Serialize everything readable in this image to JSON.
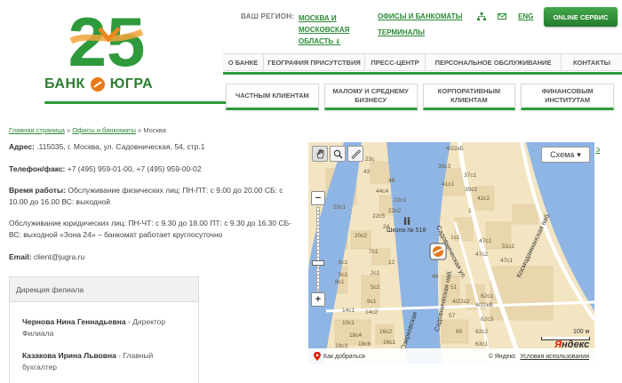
{
  "header": {
    "logo_number": "25",
    "logo_brand": "БАНК  ЮГРА",
    "region_label": "ВАШ РЕГИОН:",
    "region_value": "МОСКВА И МОСКОВСКАЯ ОБЛАСТЬ",
    "region_arrow": "⇓",
    "offices_link": "ОФИСЫ И БАНКОМАТЫ",
    "terminals_link": "ТЕРМИНАЛЫ",
    "lang_link": "ENG",
    "online_button": "ONLINE СЕРВИС",
    "icons": {
      "sitemap": "sitemap-icon",
      "mail": "mail-icon"
    }
  },
  "main_nav": [
    {
      "label": "О БАНКЕ"
    },
    {
      "label": "ГЕОГРАФИЯ ПРИСУТСТВИЯ"
    },
    {
      "label": "ПРЕСС-ЦЕНТР"
    },
    {
      "label": "ПЕРСОНАЛЬНОЕ ОБСЛУЖИВАНИЕ"
    },
    {
      "label": "КОНТАКТЫ"
    }
  ],
  "sub_nav": [
    {
      "label": "ЧАСТНЫМ КЛИЕНТАМ"
    },
    {
      "label": "МАЛОМУ И СРЕДНЕМУ БИЗНЕСУ"
    },
    {
      "label": "КОРПОРАТИВНЫМ КЛИЕНТАМ"
    },
    {
      "label": "ФИНАНСОВЫМ ИНСТИТУТАМ"
    }
  ],
  "breadcrumb": {
    "home": "Главная страница",
    "sep1": " » ",
    "section": "Офисы и банкоматы",
    "sep2": " » ",
    "current": "Москва"
  },
  "info": {
    "address_label": "Адрес:",
    "address_value": " .115035, г. Москва, ул. Садовническая, 54, стр.1",
    "phone_label": "Телефон/факс:",
    "phone_value": " +7 (495) 959-01-00, +7 (495) 959-00-02",
    "hours_label": "Время работы:",
    "hours_value": " Обслуживание физических лиц: ПН-ПТ: с 9.00 до 20.00 СБ: с 10.00 до 16.00 ВС: выходной",
    "legal_hours": "Обслуживание юридических лиц: ПН-ЧТ: с 9.30 до 18.00 ПТ: с 9.30 до 16.30 СБ-ВС: выходной «Зона 24» – банкомат работает круглосуточно",
    "email_label": "Email:",
    "email_value": " client@jugra.ru"
  },
  "branch": {
    "header": "Дирекция филиала",
    "people": [
      {
        "name": "Чернова Нина Геннадьевна",
        "role": " - Директор Филиала"
      },
      {
        "name": "Казакова Ирина Львовна",
        "role": " - Главный бухгалтер"
      }
    ]
  },
  "map": {
    "scheme_button": "Схема",
    "scheme_arrow": "▾",
    "scale_label": "100 м",
    "yandex_y": "Я",
    "yandex_rest": "ндекс",
    "route_link": "Как добраться",
    "copyright": "© Яндекс",
    "terms_link": "Условия использования",
    "streets": {
      "kosmodamianskaya": "Космодамианская наб.",
      "sadovnicheskaya_ul": "Садовническая ул.",
      "sadovnicheskaya_nab": "Садовническая наб.",
      "ozerkovskaya": "Озерковская",
      "school": "Школа № 518"
    },
    "buildings": [
      "4/22кБ",
      "39с3",
      "23с",
      "43",
      "37с1",
      "46",
      "41с1",
      "44с4",
      "39с1",
      "42с2",
      "1",
      "22с1",
      "22с2",
      "22с5",
      "20с1",
      "47с1",
      "24",
      "1с1",
      "20с2",
      "47с2",
      "51с2",
      "47с1",
      "12",
      "7с1",
      "6с1",
      "8с1",
      "5с1",
      "2с1",
      "49",
      "51",
      "5с2",
      "9с1",
      "62с1",
      "4/22с2",
      "4/22кВ",
      "14с1",
      "14с2",
      "10с1",
      "57",
      "62с3",
      "16с2",
      "16с1",
      "60",
      "62с2",
      "18с4",
      "18с6",
      "18с3",
      "63с1"
    ],
    "icons": {
      "hand": "hand-icon",
      "magnifier": "magnifier-icon",
      "ruler": "ruler-icon",
      "marker": "bank-marker-icon",
      "school": "school-icon",
      "pin": "pin-icon"
    }
  },
  "side_link": "Э",
  "colors": {
    "brand_green": "#2e9a3c",
    "link_green": "#2b8a36",
    "river": "#8fb5e4",
    "map_bg": "#f3e5c2"
  }
}
